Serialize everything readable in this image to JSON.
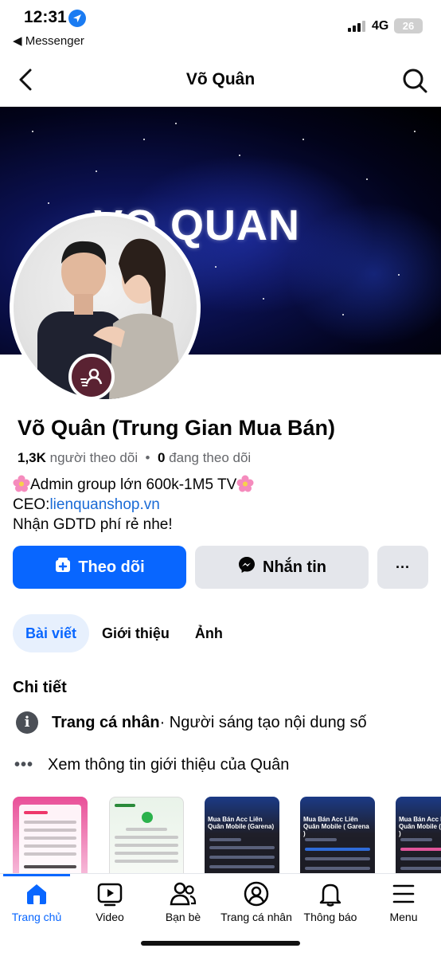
{
  "status_bar": {
    "time": "12:31",
    "back_app": "◀ Messenger",
    "network": "4G",
    "battery": "26"
  },
  "header": {
    "title": "Võ Quân"
  },
  "cover": {
    "text": "VO QUAN"
  },
  "profile": {
    "name": "Võ Quân (Trung Gian Mua Bán)",
    "followers_count": "1,3K",
    "followers_label": "người theo dõi",
    "following_count": "0",
    "following_label": "đang theo dõi",
    "bio_line1": "Admin group lớn 600k-1M5 TV",
    "bio_ceo_prefix": "CEO:",
    "bio_link": "lienquanshop.vn",
    "bio_line3": "Nhận GDTD phí rẻ nhe!"
  },
  "actions": {
    "follow_label": "Theo dõi",
    "message_label": "Nhắn tin",
    "more_label": "···"
  },
  "tabs": [
    {
      "label": "Bài viết",
      "active": true
    },
    {
      "label": "Giới thiệu",
      "active": false
    },
    {
      "label": "Ảnh",
      "active": false
    }
  ],
  "details": {
    "section_title": "Chi tiết",
    "page_type": "Trang cá nhân",
    "category": " · Người sáng tạo nội dung số",
    "see_more": "Xem thông tin giới thiệu của Quân"
  },
  "featured": [
    {
      "style": "pink",
      "title": ""
    },
    {
      "style": "light",
      "title": ""
    },
    {
      "style": "dark",
      "title": "Mua Bán Acc Liên Quân Mobile (Garena)"
    },
    {
      "style": "dark",
      "title": "Mua Bán Acc Liên Quân Mobile ( Garena )"
    },
    {
      "style": "dark",
      "title": "Mua Bán Acc Liên Quân Mobile ( Garena )"
    }
  ],
  "bottom_nav": [
    {
      "label": "Trang chủ",
      "icon": "home-icon",
      "active": true
    },
    {
      "label": "Video",
      "icon": "video-icon",
      "active": false
    },
    {
      "label": "Bạn bè",
      "icon": "friends-icon",
      "active": false
    },
    {
      "label": "Trang cá nhân",
      "icon": "profile-icon",
      "active": false
    },
    {
      "label": "Thông báo",
      "icon": "bell-icon",
      "active": false
    },
    {
      "label": "Menu",
      "icon": "menu-icon",
      "active": false
    }
  ],
  "colors": {
    "accent": "#0866ff",
    "link": "#1a6bd6",
    "secondary_button": "#e4e6eb"
  }
}
